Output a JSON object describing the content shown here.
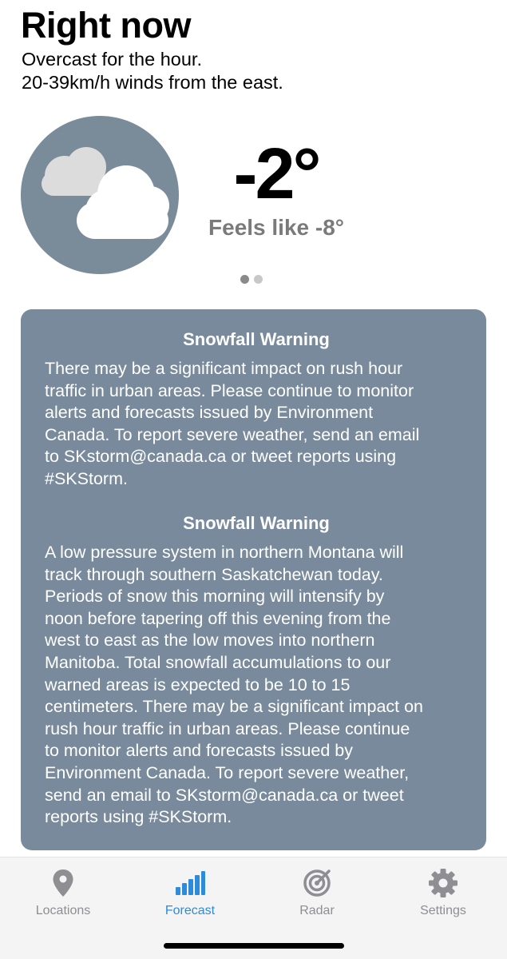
{
  "header": {
    "title": "Right now",
    "summary_lines": [
      "Overcast for the hour.",
      "20-39km/h winds from the east."
    ]
  },
  "current": {
    "icon": "cloud-icon",
    "temperature": "-2°",
    "feels_like": "Feels like -8°"
  },
  "pager": {
    "total": 2,
    "active_index": 0
  },
  "alerts": [
    {
      "title": "Snowfall Warning",
      "lines": [
        "There may be a significant impact on rush hour",
        "traffic in urban areas. Please continue to monitor",
        "alerts and forecasts issued by Environment",
        "Canada. To report severe weather, send an email",
        "to SKstorm@canada.ca or tweet reports using",
        "#SKStorm."
      ]
    },
    {
      "title": "Snowfall Warning",
      "lines": [
        "A low pressure system in northern Montana will",
        "track through southern Saskatchewan today.",
        "Periods of snow this morning will intensify by",
        "noon before tapering off this evening from the",
        "west to east as the low moves into northern",
        "Manitoba. Total snowfall accumulations to our",
        "warned areas is expected to be 10 to 15",
        "centimeters. There may be a significant impact on",
        "rush hour traffic in urban areas. Please continue",
        "to monitor alerts and forecasts issued by",
        "Environment Canada. To report severe weather,",
        "send an email to SKstorm@canada.ca or tweet",
        "reports using #SKStorm."
      ]
    }
  ],
  "tabbar": {
    "items": [
      {
        "label": "Locations",
        "icon": "map-pin-icon",
        "active": false
      },
      {
        "label": "Forecast",
        "icon": "bar-chart-icon",
        "active": true
      },
      {
        "label": "Radar",
        "icon": "radar-icon",
        "active": false
      },
      {
        "label": "Settings",
        "icon": "gear-icon",
        "active": false
      }
    ]
  },
  "colors": {
    "accent": "#2d8bd9",
    "alert_background": "#788a9b",
    "icon_circle": "#7a8b9a",
    "inactive_tab": "#8e8e93",
    "feels_like_text": "#7a7a7a"
  }
}
